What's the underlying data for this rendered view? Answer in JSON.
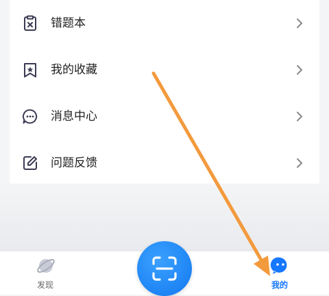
{
  "menu": {
    "items": [
      {
        "label": "错题本",
        "icon": "wrong-questions-icon"
      },
      {
        "label": "我的收藏",
        "icon": "bookmark-icon"
      },
      {
        "label": "消息中心",
        "icon": "message-icon"
      },
      {
        "label": "问题反馈",
        "icon": "feedback-icon"
      }
    ]
  },
  "tabbar": {
    "discover_label": "发现",
    "scan_icon": "scan-icon",
    "mine_label": "我的",
    "active_tab": "我的"
  },
  "colors": {
    "accent": "#1677ff",
    "arrow": "#f39a3d",
    "inactive": "#666666"
  }
}
